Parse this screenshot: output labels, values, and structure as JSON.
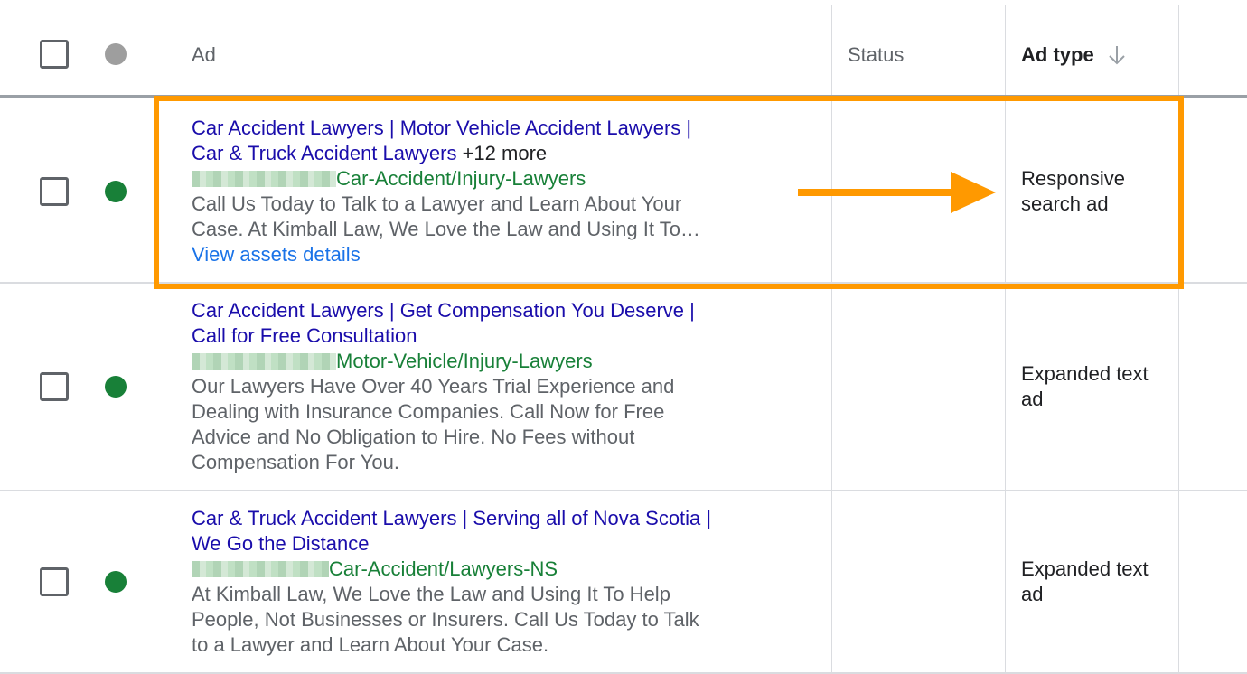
{
  "header": {
    "ad_label": "Ad",
    "status_label": "Status",
    "type_label": "Ad type",
    "sort_icon": "arrow-down-icon",
    "status_dot_color": "#9e9e9e"
  },
  "rows": [
    {
      "headline_1": "Car Accident Lawyers | Motor Vehicle Accident Lawyers |",
      "headline_2": "Car & Truck Accident Lawyers",
      "more": "+12 more",
      "url_path": "Car-Accident/Injury-Lawyers",
      "desc_1": "Call Us Today to Talk to a Lawyer and Learn About Your",
      "desc_2": "Case. At Kimball Law, We Love the Law and Using It To…",
      "link": "View assets details",
      "status": "",
      "type_1": "Responsive",
      "type_2": "search ad",
      "status_dot_color": "#188038"
    },
    {
      "headline_1": "Car Accident Lawyers | Get Compensation You Deserve |",
      "headline_2": "Call for Free Consultation",
      "url_path": "Motor-Vehicle/Injury-Lawyers",
      "desc_1": "Our Lawyers Have Over 40 Years Trial Experience and",
      "desc_2": "Dealing with Insurance Companies. Call Now for Free",
      "desc_3": "Advice and No Obligation to Hire. No Fees without",
      "desc_4": "Compensation For You.",
      "status": "",
      "type_1": "Expanded text",
      "type_2": "ad",
      "status_dot_color": "#188038"
    },
    {
      "headline_1": "Car & Truck Accident Lawyers | Serving all of Nova Scotia |",
      "headline_2": "We Go the Distance",
      "url_path": "Car-Accident/Lawyers-NS",
      "desc_1": "At Kimball Law, We Love the Law and Using It To Help",
      "desc_2": "People, Not Businesses or Insurers. Call Us Today to Talk",
      "desc_3": "to a Lawyer and Learn About Your Case.",
      "status": "",
      "type_1": "Expanded text",
      "type_2": "ad",
      "status_dot_color": "#188038"
    }
  ],
  "annotation": {
    "highlight_color": "#ff9900",
    "arrow_icon": "arrow-right-icon"
  }
}
